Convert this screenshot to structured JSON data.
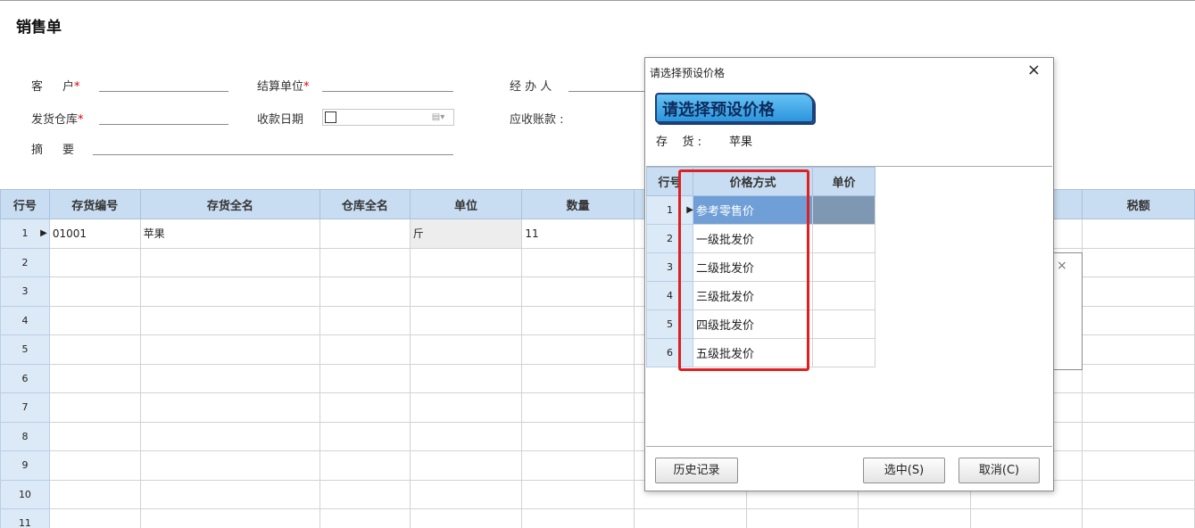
{
  "page": {
    "title": "销售单"
  },
  "form": {
    "customer": {
      "label_a": "客",
      "label_b": "户",
      "required": "*"
    },
    "settle_unit": {
      "label": "结算单位",
      "required": "*"
    },
    "handler": {
      "label": "经 办 人"
    },
    "warehouse": {
      "label": "发货仓库",
      "required": "*"
    },
    "receipt_date": {
      "label": "收款日期"
    },
    "receivable": {
      "label": "应收账款 :"
    },
    "summary": {
      "label_a": "摘",
      "label_b": "要"
    }
  },
  "grid": {
    "columns": [
      "行号",
      "存货编号",
      "存货全名",
      "仓库全名",
      "单位",
      "数量",
      "",
      "",
      "",
      "",
      "税额"
    ],
    "rows": [
      {
        "no": "1",
        "code": "01001",
        "name": "苹果",
        "unit": "斤",
        "qty": "11"
      },
      {
        "no": "2"
      },
      {
        "no": "3"
      },
      {
        "no": "4"
      },
      {
        "no": "5"
      },
      {
        "no": "6"
      },
      {
        "no": "7"
      },
      {
        "no": "8"
      },
      {
        "no": "9"
      },
      {
        "no": "10"
      },
      {
        "no": "11"
      }
    ],
    "row_pointer": "▶"
  },
  "dialog": {
    "title": "请选择预设价格",
    "close_glyph": "×",
    "banner": "请选择预设价格",
    "inventory_label": "存    货 :",
    "inventory_value": "苹果",
    "columns": [
      "行号",
      "价格方式",
      "单价"
    ],
    "rows": [
      {
        "no": "1",
        "method": "参考零售价",
        "price": ""
      },
      {
        "no": "2",
        "method": "一级批发价",
        "price": ""
      },
      {
        "no": "3",
        "method": "二级批发价",
        "price": ""
      },
      {
        "no": "4",
        "method": "三级批发价",
        "price": ""
      },
      {
        "no": "5",
        "method": "四级批发价",
        "price": ""
      },
      {
        "no": "6",
        "method": "五级批发价",
        "price": ""
      }
    ],
    "buttons": {
      "history": "历史记录",
      "select": "选中(S)",
      "cancel": "取消(C)"
    }
  },
  "underlying": {
    "close_glyph": "×"
  },
  "colors": {
    "header_bg": "#c9ddf2",
    "selected_row": "#6f9fd6",
    "highlight": "#e02020"
  }
}
